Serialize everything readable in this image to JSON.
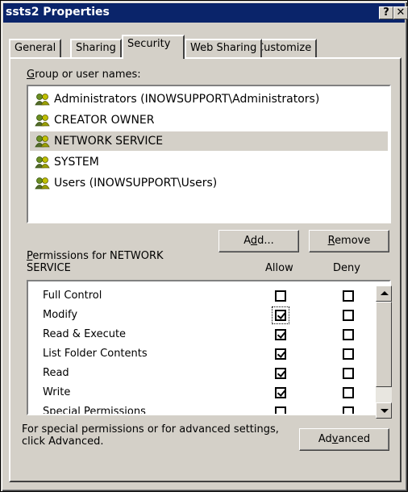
{
  "window": {
    "title": "ssts2 Properties",
    "help_glyph": "?",
    "close_glyph": "✕"
  },
  "tabs": [
    {
      "label": "General"
    },
    {
      "label": "Sharing"
    },
    {
      "label": "Security",
      "active": true
    },
    {
      "label": "Web Sharing"
    },
    {
      "label": "Customize"
    }
  ],
  "group_label": {
    "first_letter": "G",
    "rest": "roup or user names:"
  },
  "users": [
    {
      "name": "Administrators (INOWSUPPORT\\Administrators)",
      "icon": "users-group-icon"
    },
    {
      "name": "CREATOR OWNER",
      "icon": "users-group-icon"
    },
    {
      "name": "NETWORK SERVICE",
      "icon": "users-group-icon",
      "selected": true
    },
    {
      "name": "SYSTEM",
      "icon": "users-group-icon"
    },
    {
      "name": "Users (INOWSUPPORT\\Users)",
      "icon": "users-group-icon"
    }
  ],
  "buttons": {
    "add": {
      "pre": "A",
      "hot": "d",
      "post": "d..."
    },
    "remove": {
      "pre": "",
      "hot": "R",
      "post": "emove"
    },
    "advanced": {
      "pre": "Ad",
      "hot": "v",
      "post": "anced"
    }
  },
  "permissions": {
    "label_first": "P",
    "label_line1_rest": "ermissions for NETWORK",
    "label_line2": "SERVICE",
    "allow_header": "Allow",
    "deny_header": "Deny",
    "rows": [
      {
        "name": "Full Control",
        "allow": false,
        "deny": false
      },
      {
        "name": "Modify",
        "allow": true,
        "deny": false,
        "focused": true
      },
      {
        "name": "Read & Execute",
        "allow": true,
        "deny": false
      },
      {
        "name": "List Folder Contents",
        "allow": true,
        "deny": false
      },
      {
        "name": "Read",
        "allow": true,
        "deny": false
      },
      {
        "name": "Write",
        "allow": true,
        "deny": false
      },
      {
        "name": "Special Permissions",
        "allow": false,
        "deny": false
      }
    ]
  },
  "advanced_note": {
    "line1": "For special permissions or for advanced settings,",
    "line2": "click Advanced."
  }
}
